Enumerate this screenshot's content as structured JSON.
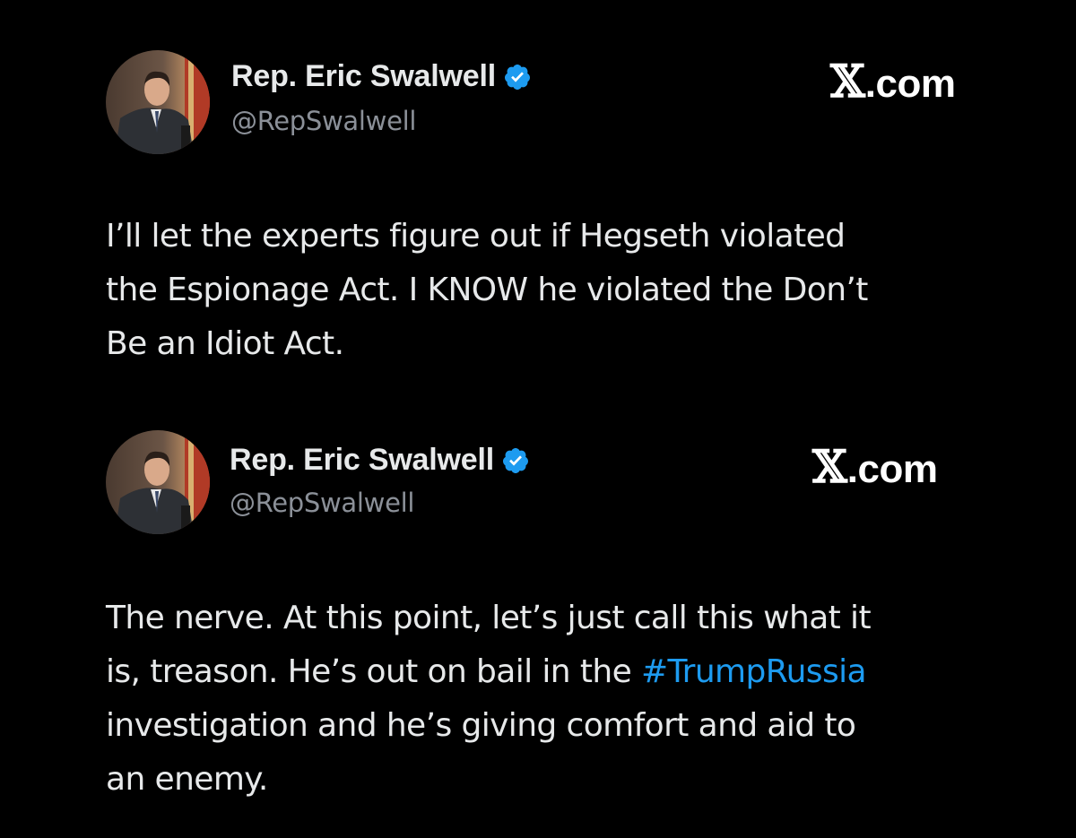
{
  "colors": {
    "background": "#000000",
    "text": "#e7e9ea",
    "handle": "#8b9098",
    "verified_badge": "#1d9bf0",
    "link": "#1d9bf0"
  },
  "posts": [
    {
      "display_name": "Rep. Eric Swalwell",
      "handle": "@RepSwalwell",
      "verified_icon": "verified-badge-icon",
      "brand_x": "𝕏",
      "brand_suffix": ".com",
      "body_lines": [
        "I’ll let the experts figure out if Hegseth violated",
        "the Espionage Act. I KNOW he violated the Don’t",
        "Be an Idiot Act."
      ]
    },
    {
      "display_name": "Rep. Eric Swalwell",
      "handle": "@RepSwalwell",
      "verified_icon": "verified-badge-icon",
      "brand_x": "𝕏",
      "brand_suffix": ".com",
      "body_line_1": "The nerve. At this point, let’s just call this what it",
      "body_line_2_before": "is, treason. He’s out on bail in the ",
      "body_line_2_hashtag": "#TrumpRussia",
      "body_line_3": "investigation and he’s giving comfort and aid to",
      "body_line_4": "an enemy."
    }
  ]
}
